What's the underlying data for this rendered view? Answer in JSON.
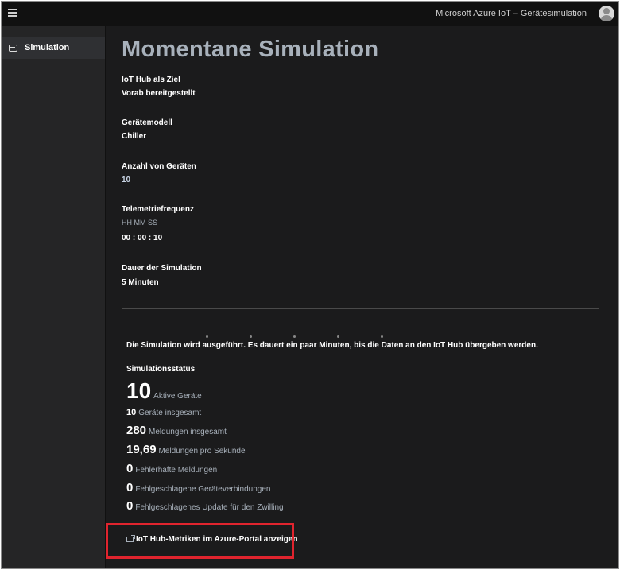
{
  "header": {
    "app_title": "Microsoft Azure IoT – Gerätesimulation",
    "menu_icon": "hamburger-icon",
    "avatar_icon": "user-avatar-icon"
  },
  "sidebar": {
    "items": [
      {
        "label": "Simulation",
        "icon": "simulation-icon"
      }
    ]
  },
  "main": {
    "title": "Momentane Simulation",
    "fields": {
      "iot_hub": {
        "label": "IoT Hub als Ziel",
        "value": "Vorab bereitgestellt"
      },
      "device_model": {
        "label": "Gerätemodell",
        "value": "Chiller"
      },
      "device_count": {
        "label": "Anzahl von Geräten",
        "value": "10"
      },
      "telemetry": {
        "label": "Telemetriefrequenz",
        "hint": "HH MM SS",
        "value": "00 : 00 : 10"
      },
      "duration": {
        "label": "Dauer der Simulation",
        "value": "5 Minuten"
      }
    },
    "progress_message": "Die Simulation wird ausgeführt. Es dauert ein paar Minuten, bis die Daten an den IoT Hub übergeben werden.",
    "status": {
      "title": "Simulationsstatus",
      "active_devices": {
        "value": "10",
        "label": "Aktive Geräte"
      },
      "total_devices": {
        "value": "10",
        "label": "Geräte insgesamt"
      },
      "total_messages": {
        "value": "280",
        "label": "Meldungen insgesamt"
      },
      "messages_per_second": {
        "value": "19,69",
        "label": "Meldungen pro Sekunde"
      },
      "failed_messages": {
        "value": "0",
        "label": "Fehlerhafte Meldungen"
      },
      "failed_connections": {
        "value": "0",
        "label": "Fehlgeschlagene Geräteverbindungen"
      },
      "failed_twin_updates": {
        "value": "0",
        "label": "Fehlgeschlagenes Update für den Zwilling"
      }
    },
    "portal_link": {
      "label": "IoT Hub-Metriken im Azure-Portal anzeigen",
      "icon": "external-link-icon"
    }
  },
  "colors": {
    "background": "#1b1b1c",
    "sidebar": "#252526",
    "title_accent": "#a8b1bb",
    "highlight_border": "#e0242e"
  }
}
